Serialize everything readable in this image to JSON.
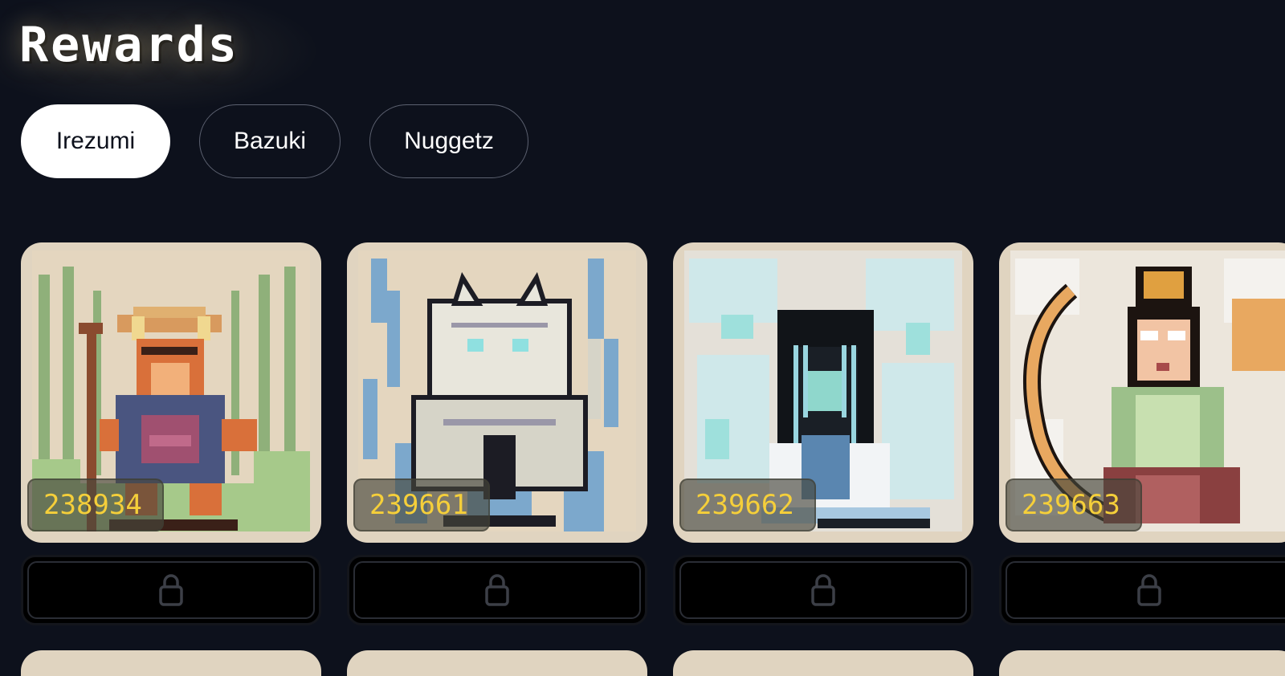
{
  "header": {
    "title": "Rewards"
  },
  "tabs": [
    {
      "label": "Irezumi",
      "active": true
    },
    {
      "label": "Bazuki",
      "active": false
    },
    {
      "label": "Nuggetz",
      "active": false
    }
  ],
  "cards": [
    {
      "id": "238934",
      "icon": "fox-samurai-art",
      "locked": true
    },
    {
      "id": "239661",
      "icon": "white-tiger-art",
      "locked": true
    },
    {
      "id": "239662",
      "icon": "ghost-woman-art",
      "locked": true
    },
    {
      "id": "239663",
      "icon": "fan-dancer-art",
      "locked": true
    }
  ],
  "colors": {
    "background": "#0d111c",
    "card": "#e0d4c0",
    "badge_text": "#f5cf3a",
    "tab_active_bg": "#ffffff"
  }
}
